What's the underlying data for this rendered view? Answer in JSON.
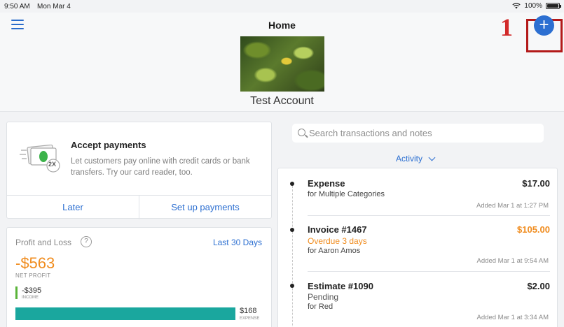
{
  "status": {
    "time": "9:50 AM",
    "date": "Mon Mar 4",
    "battery": "100%"
  },
  "header": {
    "title": "Home",
    "account_name": "Test Account",
    "annotation_number": "1"
  },
  "search": {
    "placeholder": "Search transactions and notes"
  },
  "activity": {
    "label": "Activity"
  },
  "payments": {
    "title": "Accept payments",
    "description": "Let customers pay online with credit cards or bank transfers. Try our card reader, too.",
    "icon_badge": "2X",
    "later_label": "Later",
    "setup_label": "Set up payments"
  },
  "profit_loss": {
    "title": "Profit and Loss",
    "period": "Last 30 Days",
    "net_amount": "-$563",
    "net_label": "NET PROFIT",
    "income_amount": "-$395",
    "income_label": "INCOME",
    "expense_amount": "$168",
    "expense_label": "EXPENSE"
  },
  "transactions": [
    {
      "title": "Expense",
      "amount": "$17.00",
      "status": "",
      "sub": "for Multiple Categories",
      "added": "Added Mar 1 at 1:27 PM"
    },
    {
      "title": "Invoice #1467",
      "amount": "$105.00",
      "status": "Overdue 3 days",
      "sub": "for Aaron Amos",
      "added": "Added Mar 1 at 9:54 AM"
    },
    {
      "title": "Estimate #1090",
      "amount": "$2.00",
      "status": "Pending",
      "sub": "for Red",
      "added": "Added Mar 1 at 3:34 AM"
    }
  ],
  "colors": {
    "accent": "#2c6fd1",
    "overdue": "#f08c1e",
    "income": "#5ab43a",
    "expense": "#1aa79e",
    "annotation": "#d22a2a"
  },
  "icons": [
    "menu-icon",
    "plus-icon",
    "search-icon",
    "chevron-down-icon",
    "help-icon",
    "wifi-icon",
    "battery-icon",
    "payments-card-icon"
  ]
}
